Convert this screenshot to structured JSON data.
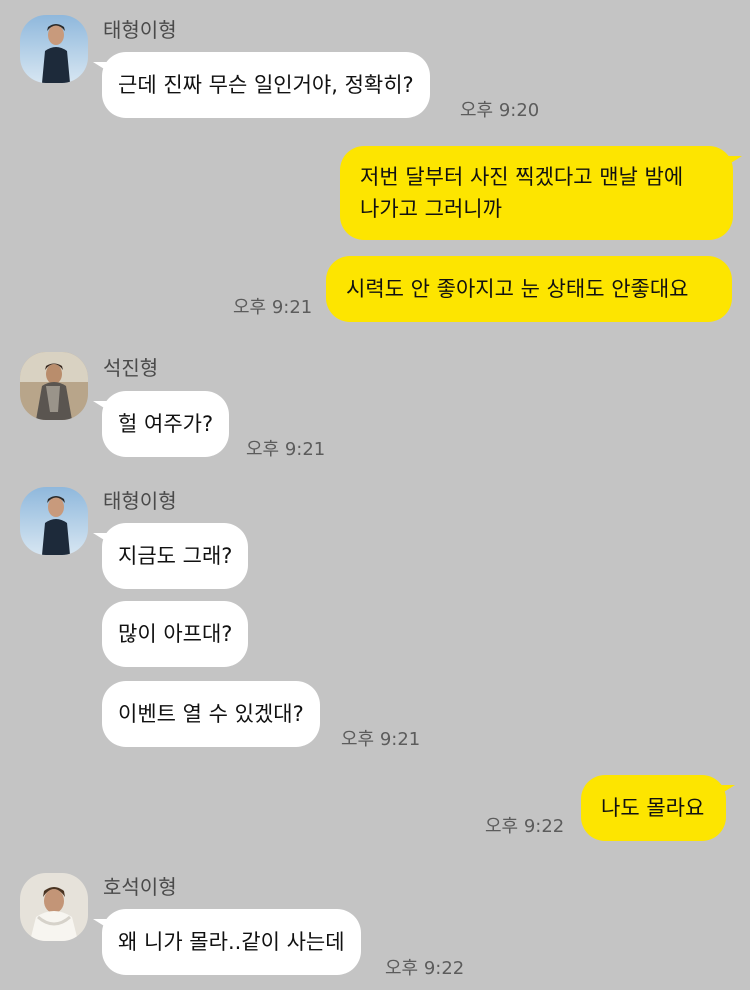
{
  "messages": [
    {
      "sender": "태형이형",
      "text": "근데 진짜 무슨 일인거야, 정확히?",
      "time": "오후 9:20"
    },
    {
      "line1": "저번 달부터 사진 찍겠다고 맨날 밤에",
      "line2": "나가고 그러니까"
    },
    {
      "text": "시력도 안 좋아지고 눈 상태도 안좋대요",
      "time": "오후 9:21"
    },
    {
      "sender": "석진형",
      "text": "헐 여주가?",
      "time": "오후 9:21"
    },
    {
      "sender": "태형이형",
      "text": "지금도 그래?"
    },
    {
      "text": "많이 아프대?"
    },
    {
      "text": "이벤트 열 수 있겠대?",
      "time": "오후 9:21"
    },
    {
      "text": "나도 몰라요",
      "time": "오후 9:22"
    },
    {
      "sender": "호석이형",
      "text": "왜 니가 몰라..같이 사는데",
      "time": "오후 9:22"
    }
  ],
  "avatars": {
    "taehyung": "avatar-photo-man-blue-sky",
    "seokjin": "avatar-photo-man-scarf",
    "hoseok": "avatar-photo-man-white-hoodie"
  }
}
